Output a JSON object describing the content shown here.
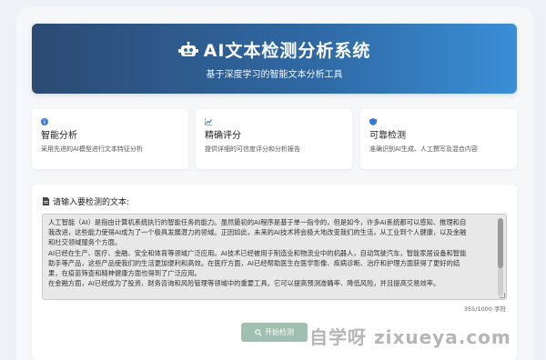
{
  "header": {
    "title": "AI文本检测分析系统",
    "subtitle": "基于深度学习的智能文本分析工具",
    "icon": "robot-icon"
  },
  "features": [
    {
      "icon": "info-icon",
      "color": "#3a7bd5",
      "title": "智能分析",
      "desc": "采用先进的AI模型进行文本特征分析"
    },
    {
      "icon": "chart-icon",
      "color": "#3a7bd5",
      "title": "精确评分",
      "desc": "提供详细的可信度评分和分析报告"
    },
    {
      "icon": "shield-icon",
      "color": "#3a7bd5",
      "title": "可靠检测",
      "desc": "准确识别AI生成、人工撰写及混合内容"
    }
  ],
  "input": {
    "label": "请输入要检测的文本:",
    "lines": [
      "人工智能（AI）是指由计算机系统执行的智能任务的能力。虽然最初的AI程序是基于单一指令的，但是如今，许多AI系统都可以感知、推理和自",
      "我改进，这些能力使得AI成为了一个极具发展潜力的领域。正因如此，未来的AI技术将会极大地改变我们的生活，从工业到个人健康，以及金融",
      "和社交领域服务个方面。",
      "AI已经在生产、医疗、金融、安全和体育等领域广泛应用。AI技术已经被用于制造业和物流业中的机器人，自动驾驶汽车，智能家居设备和智能",
      "助手等产品，这些产品使我们的生活更加便利和高效。在医疗方面，AI已经帮助医生在医学影像、疾病诊断、治疗和护理方面获得了更好的结",
      "果，在疫苗筛查和精神健康方面也得到了广泛应用。",
      "在金融方面，AI已经成为了投资、财务咨询和风险管理等领域中的重要工具，它可以提高预测准确率、降低风险，并且提高交易效率。"
    ],
    "count": "355/1000 字符"
  },
  "button": {
    "label": "开始检测"
  },
  "watermark": "自学呀 zixueya.com"
}
